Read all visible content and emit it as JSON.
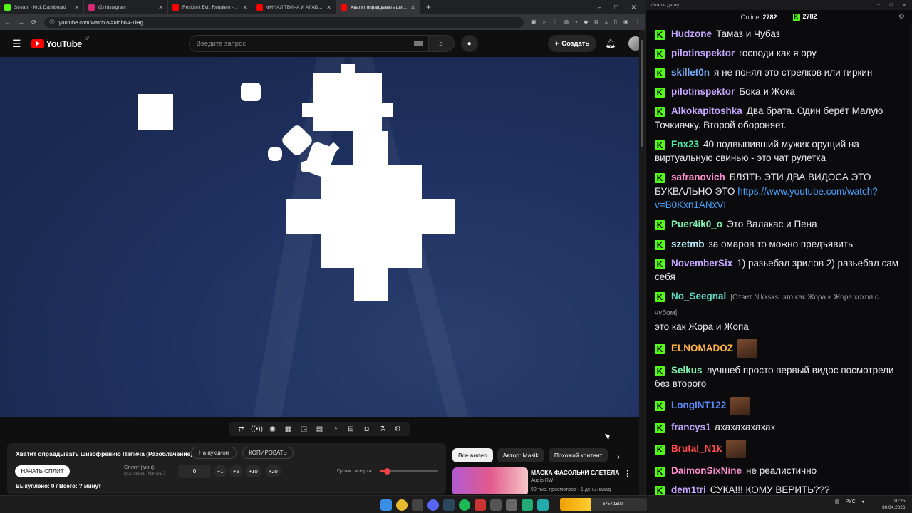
{
  "browser": {
    "tabs": [
      {
        "title": "Stream - Kick Dashboard",
        "color": "#53fc18"
      },
      {
        "title": "(2) Instagram",
        "color": "#d62976"
      },
      {
        "title": "Resident Evil: Requiem - Трасса",
        "color": "#ff0000"
      },
      {
        "title": "ФИНАЛ ТВИЧА И АЛАБУГИ - ...",
        "color": "#ff0000"
      },
      {
        "title": "Хватит оправдывать шизо...",
        "color": "#ff0000"
      }
    ],
    "url": "youtube.com/watch?v=uldbnA-1iHg",
    "window_controls": [
      "–",
      "□",
      "✕"
    ]
  },
  "youtube": {
    "logo_text": "YouTube",
    "region": "LV",
    "search_placeholder": "Введите запрос",
    "create_label": "Создать"
  },
  "panel": {
    "title": "Хватит оправдывать шизофрению Папича (Разоблачение)",
    "auction_label": "На аукцион",
    "copy_label": "КОПИРОВАТЬ",
    "start_split_label": "НАЧАТЬ СПЛИТ",
    "split_label": "Сплит (мин):",
    "split_hint": "(уст. перед \"Начать\")",
    "split_value": "0",
    "steps": [
      "+1",
      "+5",
      "+10",
      "+20"
    ],
    "volume_label": "Громк. алерта:",
    "volume_level": 0.12,
    "status": "Выкуплено: 0 / Всего: ? минут"
  },
  "chips": [
    "Все видео",
    "Автор: Masik",
    "Похожий контент"
  ],
  "recommendation": {
    "title": "МАСКА ФАСОЛЬКИ СЛЕТЕЛА",
    "channel": "Audio RW",
    "meta": "90 тыс. просмотров · 1 день назад"
  },
  "chat": {
    "window_title": "Окно в дарку",
    "online_label": "Online:",
    "online_count": "2782",
    "viewer_count": "2782",
    "messages": [
      {
        "user": "Hudzone",
        "color": "#c4a6ff",
        "text": "Тамаз и Чубаз"
      },
      {
        "user": "pilotinspektor",
        "color": "#c4a6ff",
        "text": "господи как я ору"
      },
      {
        "user": "skillet0n",
        "color": "#7ab0ff",
        "text": "я не понял это стрелков или гиркин"
      },
      {
        "user": "pilotinspektor",
        "color": "#c4a6ff",
        "text": "Бока и Жока"
      },
      {
        "user": "Alkokapitoshka",
        "color": "#c4a6ff",
        "text": "Два брата. Один берёт Малую Точкиачку. Второй обороняет."
      },
      {
        "user": "Fnx23",
        "color": "#4fe8a8",
        "text": "40 подвыпивший мужик орущий на виртуальную свинью - это чат рулетка"
      },
      {
        "user": "safranovich",
        "color": "#ff8fd0",
        "text": "БЛЯТЬ ЭТИ ДВА ВИДОСА ЭТО БУКВАЛЬНО ЭТО",
        "link": "https://www.youtube.com/watch?v=B0Kxn1ANxVI"
      },
      {
        "user": "Puer4ik0_o",
        "color": "#7ef0b0",
        "text": "Это Валакас и Пена"
      },
      {
        "user": "szetmb",
        "color": "#b9ecff",
        "text": "за омаров то можно предъявить"
      },
      {
        "user": "NovemberSix",
        "color": "#c4a6ff",
        "text": "1) разьебал зрилов 2) разьебал сам себя"
      },
      {
        "user": "No_Seegnal",
        "color": "#5fd8c0",
        "reply": "[Ответ Nikksks: это как Жора и Жора хохол с чубом]",
        "text": "это как Жора и Жопа"
      },
      {
        "user": "ELNOMADOZ",
        "color": "#ffb347",
        "text": "",
        "emote": "emote-face"
      },
      {
        "user": "Selkus",
        "color": "#7ef0b0",
        "text": "лучшеб просто первый видос посмотрели без второго"
      },
      {
        "user": "LongINT122",
        "color": "#5b8cff",
        "text": "",
        "emote": "emote-face"
      },
      {
        "user": "francys1",
        "color": "#c4a6ff",
        "text": "ахахахахахах"
      },
      {
        "user": "Brutal_N1k",
        "color": "#ff4d4d",
        "text": "",
        "emote": "emote-face"
      },
      {
        "user": "DaimonSixNine",
        "color": "#ff8fd0",
        "text": "не реалистично"
      },
      {
        "user": "dem1tri",
        "color": "#c4a6ff",
        "text": "СУКА!!! КОМУ ВЕРИТЬ???"
      }
    ]
  },
  "taskbar": {
    "widget_text": "675 / 1500",
    "lang": "РУС",
    "time": "20:25",
    "date": "30.04.2026"
  }
}
